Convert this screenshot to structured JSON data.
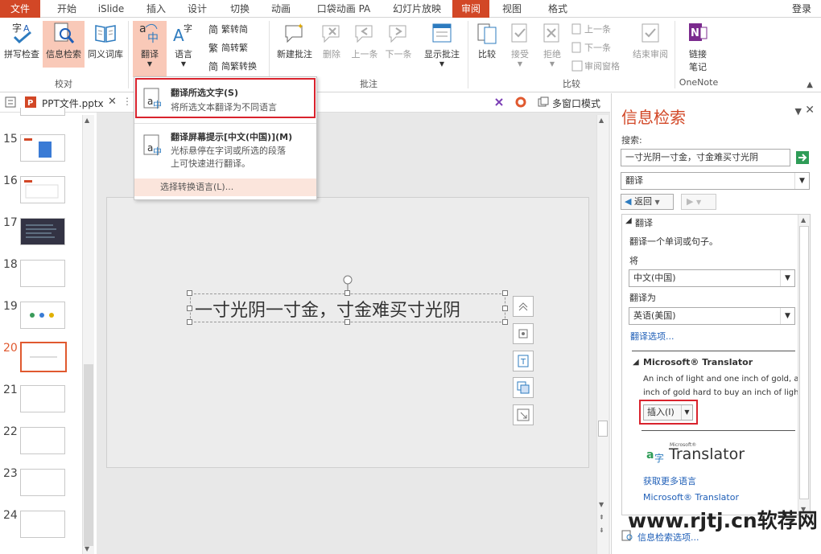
{
  "tabs": {
    "file": "文件",
    "home": "开始",
    "islide": "iSlide",
    "insert": "插入",
    "design": "设计",
    "transitions": "切换",
    "animations": "动画",
    "pocket": "口袋动画 PA",
    "slideshow": "幻灯片放映",
    "review": "审阅",
    "view": "视图",
    "format": "格式",
    "login": "登录"
  },
  "ribbon": {
    "spell_check": "拼写检查",
    "research": "信息检索",
    "thesaurus": "同义词库",
    "translate": "翻译",
    "language": "语言",
    "trad_to_simp": "繁转简",
    "simp_to_trad": "简转繁",
    "convert": "简繁转换",
    "new_comment": "新建批注",
    "delete": "删除",
    "previous": "上一条",
    "next": "下一条",
    "show_comments": "显示批注",
    "compare": "比较",
    "accept": "接受",
    "reject": "拒绝",
    "prev_change": "上一条",
    "next_change": "下一条",
    "reviewing_pane": "审阅窗格",
    "end_review": "结束审阅",
    "link_notes_line1": "链接",
    "link_notes_line2": "笔记",
    "groups": {
      "proofing": "校对",
      "comments": "批注",
      "compare": "比较",
      "onenote": "OneNote"
    }
  },
  "dropdown": {
    "item1_title": "翻译所选文字(S)",
    "item1_desc": "将所选文本翻译为不同语言",
    "item2_title": "翻译屏幕提示[中文(中国)](M)",
    "item2_desc1": "光标悬停在字词或所选的段落",
    "item2_desc2": "上可快速进行翻译。",
    "footer": "选择转换语言(L)..."
  },
  "docbar": {
    "filename": "PPT文件.pptx",
    "multiwindow": "多窗口模式"
  },
  "thumbnails": [
    {
      "num": "15"
    },
    {
      "num": "16"
    },
    {
      "num": "17"
    },
    {
      "num": "18"
    },
    {
      "num": "19"
    },
    {
      "num": "20"
    },
    {
      "num": "21"
    },
    {
      "num": "22"
    },
    {
      "num": "23"
    },
    {
      "num": "24"
    }
  ],
  "slide": {
    "text": "一寸光阴一寸金，寸金难买寸光阴"
  },
  "pane": {
    "title": "信息检索",
    "search_label": "搜索:",
    "search_value": "一寸光阴一寸金，寸金难买寸光阴",
    "service": "翻译",
    "back": "返回",
    "section": "翻译",
    "hint": "翻译一个单词或句子。",
    "from_label": "将",
    "from_value": "中文(中国)",
    "to_label": "翻译为",
    "to_value": "英语(美国)",
    "options_link": "翻译选项...",
    "ms_title": "Microsoft® Translator",
    "translation_line1": "An inch of light and one inch of gold, an",
    "translation_line2": "inch of gold hard to buy an inch of light",
    "insert_btn": "插入(I)",
    "logo_small": "Microsoft®",
    "logo_big": "Translator",
    "more_languages": "获取更多语言",
    "ms_link": "Microsoft® Translator",
    "research_options": "信息检索选项..."
  },
  "watermark": "www.rjtj.cn软荐网",
  "colors": {
    "accent": "#d24726",
    "highlight": "#f9c9b8",
    "redbox": "#d9232d",
    "link": "#1e5eb7"
  }
}
